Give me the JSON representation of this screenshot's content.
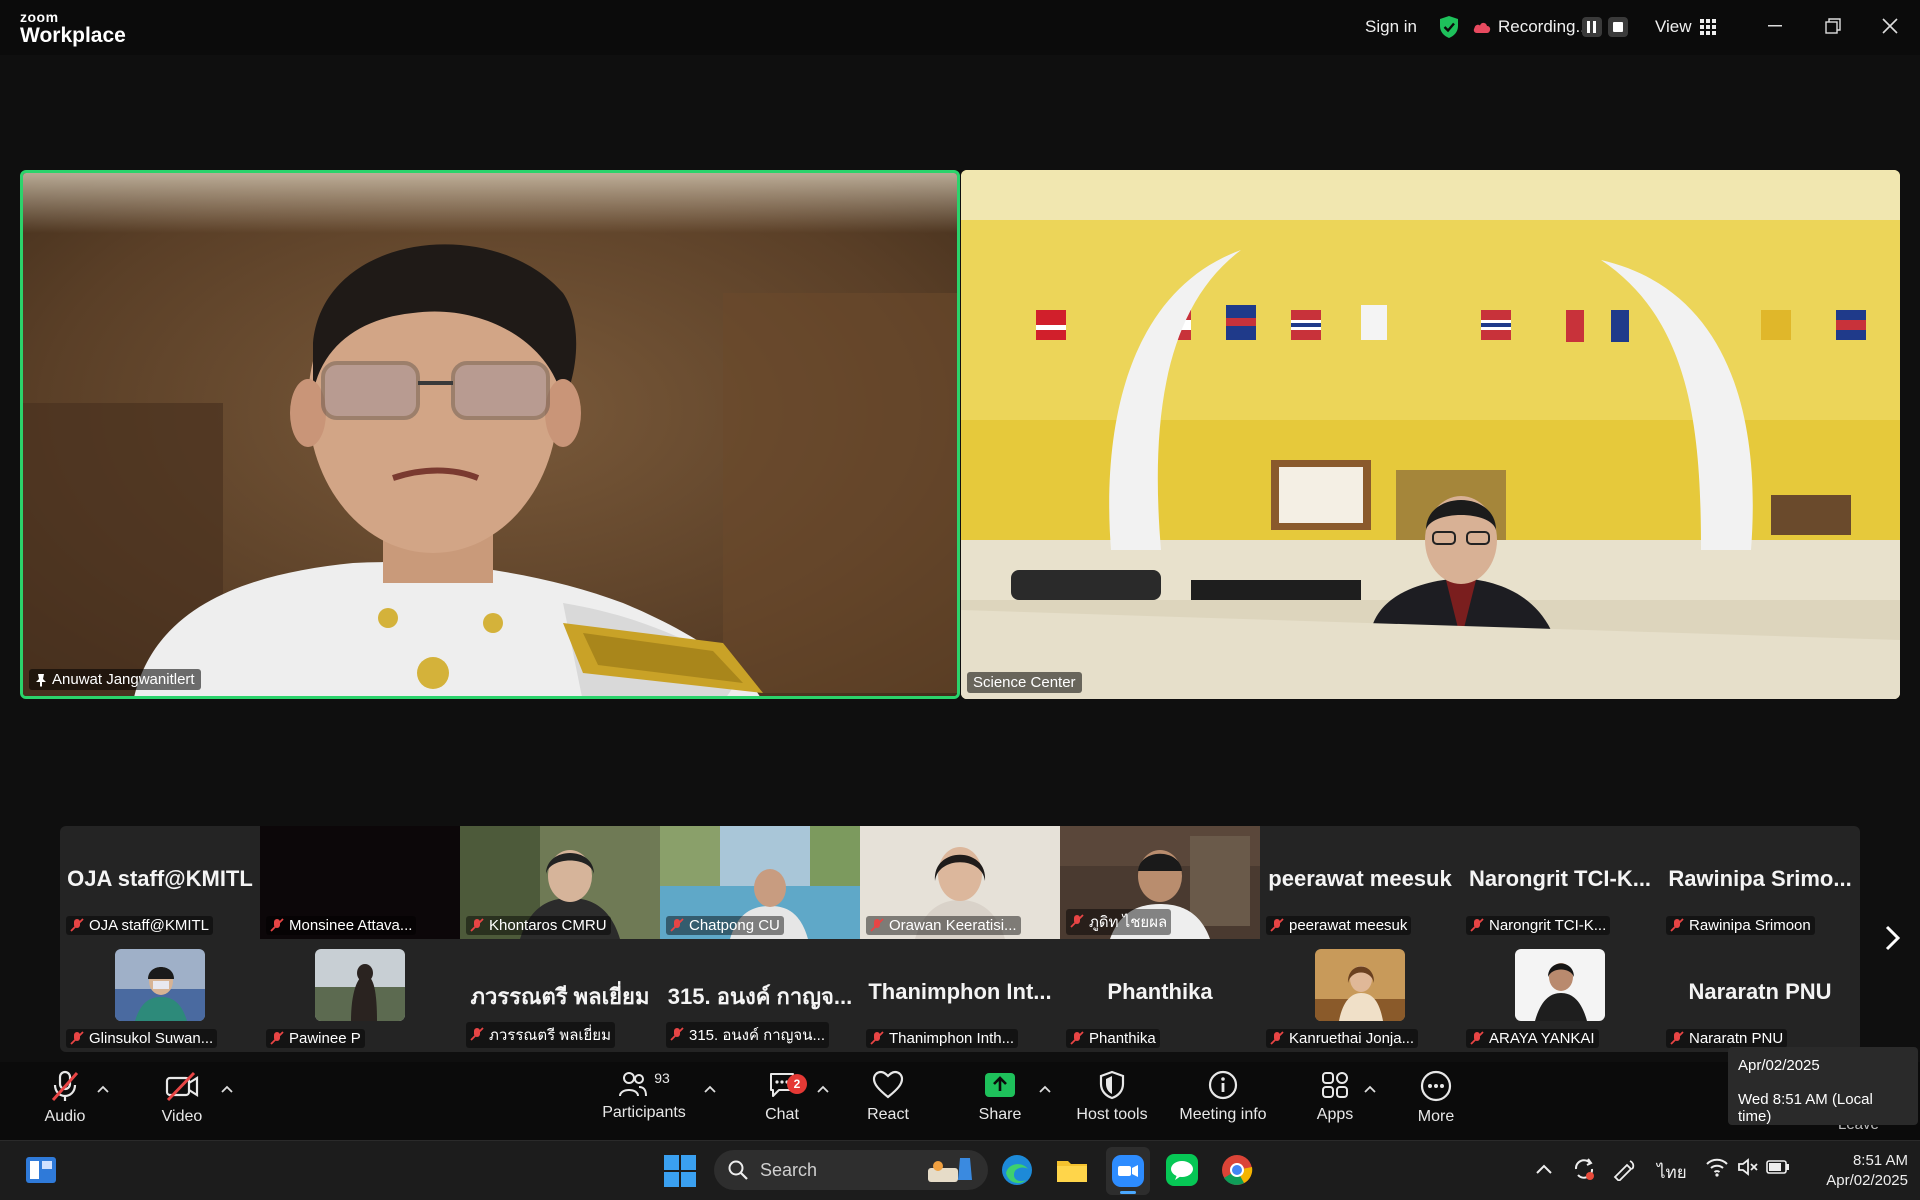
{
  "app": {
    "brand_top": "zoom",
    "brand_bottom": "Workplace"
  },
  "titlebar": {
    "sign_in": "Sign in",
    "recording": "Recording...",
    "view": "View"
  },
  "main_tiles": [
    {
      "name": "Anuwat Jangwanitlert",
      "pinned": true,
      "active_speaker": true
    },
    {
      "name": "Science Center"
    }
  ],
  "gallery": {
    "row1": [
      {
        "big": "OJA staff@KMITL",
        "label": "OJA staff@KMITL"
      },
      {
        "big": "",
        "label": "Monsinee Attava..."
      },
      {
        "big": "",
        "label": "Khontaros CMRU"
      },
      {
        "big": "",
        "label": "Chatpong CU"
      },
      {
        "big": "",
        "label": "Orawan Keeratisi..."
      },
      {
        "big": "",
        "label": "ภูดิท ไชยผล"
      },
      {
        "big": "peerawat meesuk",
        "label": "peerawat meesuk"
      },
      {
        "big": "Narongrit TCI-K...",
        "label": "Narongrit TCI-K..."
      },
      {
        "big": "Rawinipa Srimo...",
        "label": "Rawinipa Srimoon"
      }
    ],
    "row2": [
      {
        "big": "",
        "label": "Glinsukol Suwan..."
      },
      {
        "big": "",
        "label": "Pawinee P"
      },
      {
        "big": "ภวรรณตรี พลเยี่ยม",
        "label": "ภวรรณตรี พลเยี่ยม"
      },
      {
        "big": "315. อนงค์ กาญจ...",
        "label": "315. อนงค์ กาญจน..."
      },
      {
        "big": "Thanimphon Int...",
        "label": "Thanimphon Inth..."
      },
      {
        "big": "Phanthika",
        "label": "Phanthika"
      },
      {
        "big": "",
        "label": "Kanruethai Jonja..."
      },
      {
        "big": "",
        "label": "ARAYA YANKAI"
      },
      {
        "big": "Nararatn PNU",
        "label": "Nararatn PNU"
      }
    ]
  },
  "toolbar": {
    "audio": "Audio",
    "video": "Video",
    "participants": "Participants",
    "participants_count": "93",
    "chat": "Chat",
    "chat_badge": "2",
    "react": "React",
    "share": "Share",
    "host_tools": "Host tools",
    "meeting_info": "Meeting info",
    "apps": "Apps",
    "more": "More",
    "leave": "Leave"
  },
  "tooltip": {
    "date": "Apr/02/2025",
    "time": "Wed 8:51 AM (Local time)"
  },
  "taskbar": {
    "search_placeholder": "Search",
    "lang": "ไทย",
    "time": "8:51 AM",
    "date": "Apr/02/2025"
  },
  "colors": {
    "active_border": "#2bd36b",
    "share_green": "#1ec15b",
    "badge_red": "#e53935"
  }
}
